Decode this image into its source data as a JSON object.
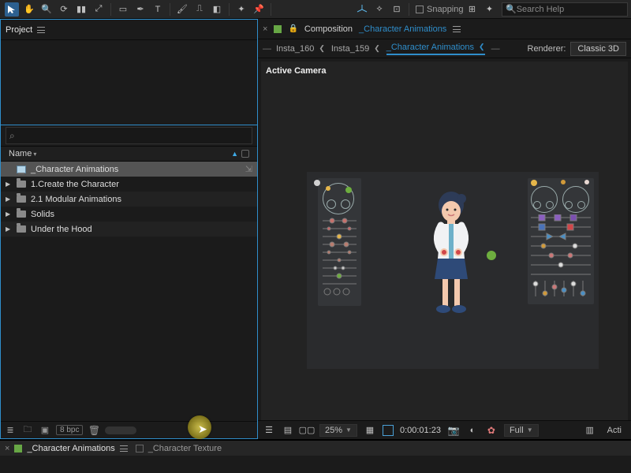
{
  "toolbar": {
    "snapping_label": "Snapping",
    "search_placeholder": "Search Help"
  },
  "project_panel": {
    "tab_label": "Project",
    "name_col": "Name",
    "search_placeholder": "",
    "items": [
      {
        "type": "comp",
        "label": "_Character Animations"
      },
      {
        "type": "folder",
        "label": "1.Create the Character"
      },
      {
        "type": "folder",
        "label": "2.1 Modular Animations"
      },
      {
        "type": "folder",
        "label": "Solids"
      },
      {
        "type": "folder",
        "label": "Under the Hood"
      }
    ],
    "footer": {
      "bpc": "8 bpc"
    }
  },
  "composition_panel": {
    "tab_label": "Composition",
    "comp_name": "_Character Animations",
    "flow": {
      "insta160": "Insta_160",
      "insta159": "Insta_159",
      "active": "_Character Animations"
    },
    "renderer_label": "Renderer:",
    "renderer_value": "Classic 3D",
    "view_label": "Active Camera",
    "footer": {
      "zoom": "25%",
      "timecode": "0:00:01:23",
      "res": "Full",
      "active_cam_short": "Acti"
    }
  },
  "timeline_tabs": {
    "tab1": "_Character Animations",
    "tab2": "_Character Texture"
  }
}
